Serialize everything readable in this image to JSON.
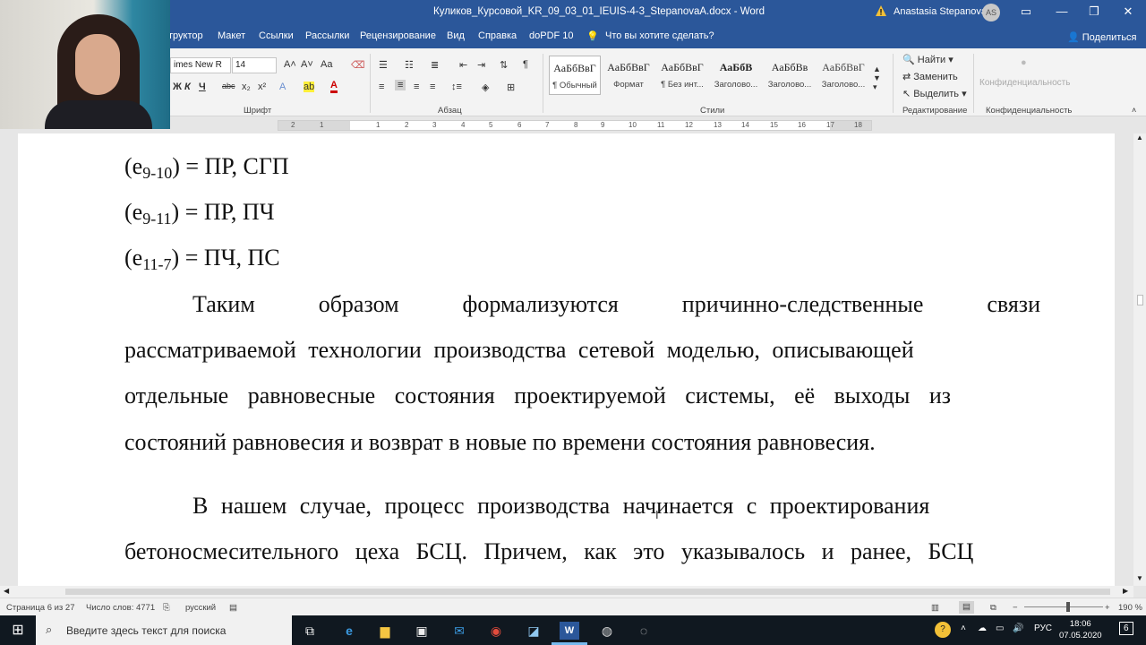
{
  "window": {
    "title": "Куликов_Курсовой_KR_09_03_01_IEUIS-4-3_StepanovaA.docx - Word",
    "user": "Anastasia Stepanova",
    "user_initials": "AS",
    "accent": "#2b579a"
  },
  "ribbon_tabs": {
    "items": [
      "труктор",
      "Макет",
      "Ссылки",
      "Рассылки",
      "Рецензирование",
      "Вид",
      "Справка",
      "doPDF 10"
    ],
    "tell_me": "Что вы хотите сделать?",
    "share": "Поделиться"
  },
  "ribbon": {
    "font_name": "imes New R",
    "font_size": "14",
    "group_font": "Шрифт",
    "group_paragraph": "Абзац",
    "group_styles": "Стили",
    "group_editing": "Редактирование",
    "group_conf": "Конфиденциальность",
    "conf_button": "Конфиденциальность",
    "find": "Найти",
    "replace": "Заменить",
    "select": "Выделить",
    "styles": [
      {
        "preview": "АаБбВвГ",
        "name": "¶ Обычный"
      },
      {
        "preview": "АаБбВвГ",
        "name": "Формат"
      },
      {
        "preview": "АаБбВвГ",
        "name": "¶ Без инт..."
      },
      {
        "preview": "АаБбВ",
        "name": "Заголово..."
      },
      {
        "preview": "АаБбВв",
        "name": "Заголово..."
      },
      {
        "preview": "АаБбВвГ",
        "name": "Заголово..."
      }
    ]
  },
  "ruler": {
    "numbers": [
      "2",
      "1",
      "1",
      "2",
      "3",
      "4",
      "5",
      "6",
      "7",
      "8",
      "9",
      "10",
      "11",
      "12",
      "13",
      "14",
      "15",
      "16",
      "17",
      "18"
    ]
  },
  "document": {
    "formula_lines": [
      {
        "pre": "(e",
        "sub": "9-10",
        "post": ") = ПР, СГП"
      },
      {
        "pre": "(e",
        "sub": "9-11",
        "post": ") = ПР, ПЧ"
      },
      {
        "pre": "(e",
        "sub": "11-7",
        "post": ") = ПЧ, ПС"
      }
    ],
    "para1_line1": [
      "Таким",
      "образом",
      "формализуются",
      "причинно-следственные",
      "связи"
    ],
    "para1_line2": "рассматриваемой технологии производства сетевой моделью, описывающей",
    "para1_line3": "отдельные равновесные состояния проектируемой системы, её выходы из",
    "para1_line4": "состояний равновесия и возврат в новые по времени состояния равновесия.",
    "para2_line1": "В нашем случае, процесс производства начинается с проектирования",
    "para2_line2": "бетоносмесительного цеха БСЦ. Причем, как это указывалось и ранее, БСЦ"
  },
  "statusbar": {
    "page": "Страница 6 из 27",
    "words": "Число слов: 4771",
    "language": "русский",
    "zoom": "190 %"
  },
  "taskbar": {
    "search_placeholder": "Введите здесь текст для поиска",
    "lang": "РУС",
    "time": "18:06",
    "date": "07.05.2020",
    "notifications": "6"
  }
}
